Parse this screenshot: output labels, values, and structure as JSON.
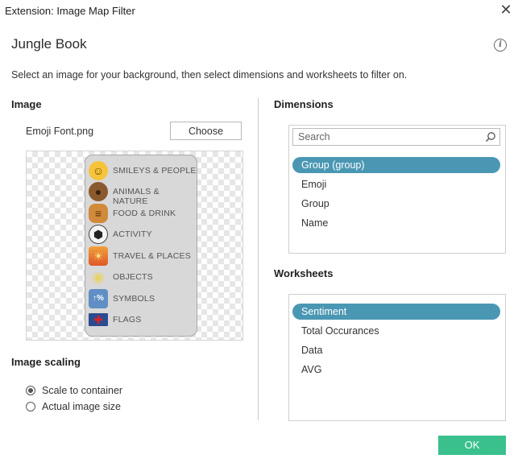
{
  "window": {
    "title": "Extension: Image Map Filter",
    "close_glyph": "✕"
  },
  "header": {
    "title": "Jungle Book",
    "info_glyph": "i"
  },
  "instructions": "Select an image for your background, then select dimensions and worksheets to filter on.",
  "image_section": {
    "label": "Image",
    "file_name": "Emoji Font.png",
    "choose_label": "Choose",
    "categories": [
      {
        "label": "SMILEYS & PEOPLE",
        "icon": "smiley-icon",
        "glyph": "☺",
        "color": "#f6c43a"
      },
      {
        "label": "ANIMALS & NATURE",
        "icon": "bear-icon",
        "glyph": "●",
        "color": "#8a5a2e"
      },
      {
        "label": "FOOD & DRINK",
        "icon": "burger-icon",
        "glyph": "≡",
        "color": "#c97a2b"
      },
      {
        "label": "ACTIVITY",
        "icon": "soccer-ball-icon",
        "glyph": "⬢",
        "color": "#f4f4f4"
      },
      {
        "label": "TRAVEL & PLACES",
        "icon": "sunset-icon",
        "glyph": "☀",
        "color": "#e86f2b"
      },
      {
        "label": "OBJECTS",
        "icon": "lightbulb-icon",
        "glyph": "◉",
        "color": "#f3e9a8"
      },
      {
        "label": "SYMBOLS",
        "icon": "symbols-icon",
        "glyph": "↑%",
        "color": "#5f8fc4"
      },
      {
        "label": "FLAGS",
        "icon": "uk-flag-icon",
        "glyph": "✚",
        "color": "#2c4a8f"
      }
    ]
  },
  "scaling": {
    "label": "Image scaling",
    "options": [
      {
        "label": "Scale to container",
        "checked": true
      },
      {
        "label": "Actual image size",
        "checked": false
      }
    ]
  },
  "dimensions": {
    "label": "Dimensions",
    "search_placeholder": "Search",
    "items": [
      "Group (group)",
      "Emoji",
      "Group",
      "Name"
    ],
    "selected_index": 0
  },
  "worksheets": {
    "label": "Worksheets",
    "items": [
      "Sentiment",
      "Total Occurances",
      "Data",
      "AVG"
    ],
    "selected_index": 0
  },
  "footer": {
    "ok_label": "OK"
  },
  "colors": {
    "selection": "#4a97b3",
    "ok_button": "#3ac08d"
  }
}
